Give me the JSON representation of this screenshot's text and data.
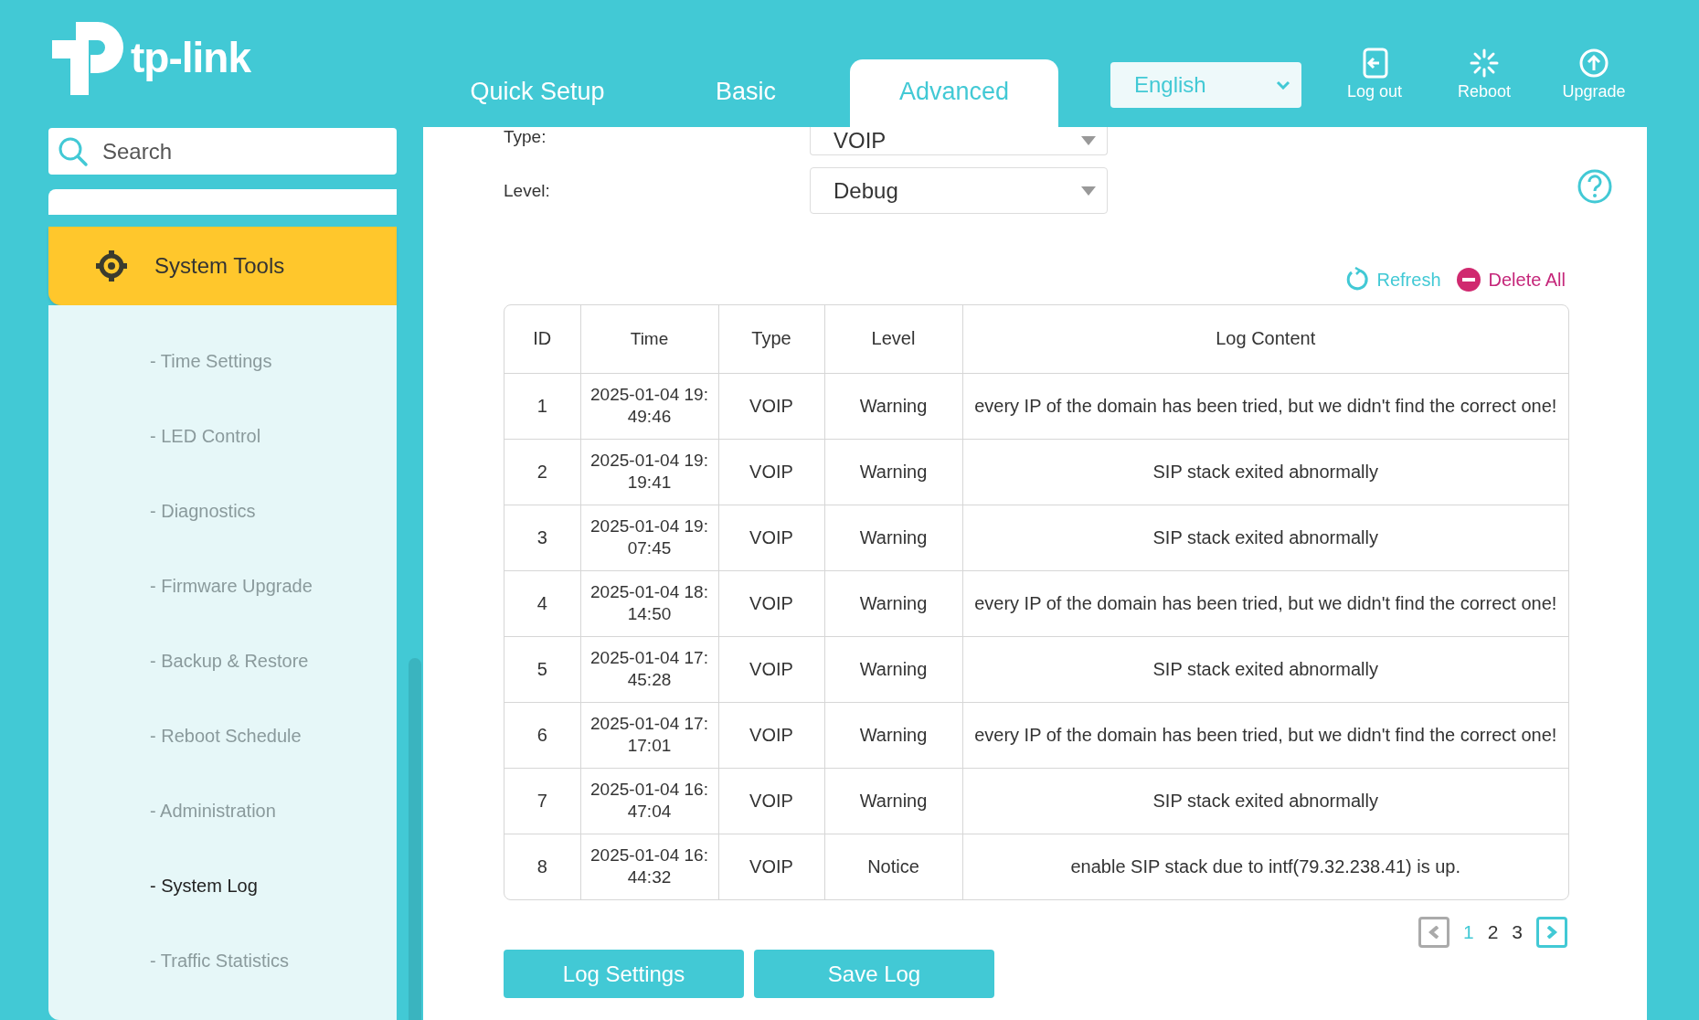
{
  "logo": {
    "text": "tp-link"
  },
  "tabs": [
    {
      "label": "Quick Setup",
      "selected": false
    },
    {
      "label": "Basic",
      "selected": false
    },
    {
      "label": "Advanced",
      "selected": true
    }
  ],
  "language": {
    "value": "English"
  },
  "header_actions": [
    {
      "kind": "logout",
      "label": "Log out"
    },
    {
      "kind": "reboot",
      "label": "Reboot"
    },
    {
      "kind": "upgrade",
      "label": "Upgrade"
    }
  ],
  "sidebar": {
    "search": {
      "placeholder": "Search"
    },
    "section": {
      "label": "System Tools",
      "expanded": true
    },
    "items": [
      {
        "label": "- Time Settings",
        "selected": false
      },
      {
        "label": "- LED Control",
        "selected": false
      },
      {
        "label": "- Diagnostics",
        "selected": false
      },
      {
        "label": "- Firmware Upgrade",
        "selected": false
      },
      {
        "label": "- Backup & Restore",
        "selected": false
      },
      {
        "label": "- Reboot Schedule",
        "selected": false
      },
      {
        "label": "- Administration",
        "selected": false
      },
      {
        "label": "- System Log",
        "selected": true
      },
      {
        "label": "- Traffic Statistics",
        "selected": false
      }
    ]
  },
  "filters": [
    {
      "label": "Type:",
      "value": "VOIP"
    },
    {
      "label": "Level:",
      "value": "Debug"
    }
  ],
  "actions": [
    {
      "kind": "refresh",
      "label": "Refresh"
    },
    {
      "kind": "delete",
      "label": "Delete All"
    }
  ],
  "table": {
    "columns": [
      "ID",
      "Time",
      "Type",
      "Level",
      "Log Content"
    ],
    "rows": [
      [
        "1",
        "2025-01-04 19:49:46",
        "VOIP",
        "Warning",
        "every IP of the domain has been tried, but we didn't find the correct one!"
      ],
      [
        "2",
        "2025-01-04 19:19:41",
        "VOIP",
        "Warning",
        "SIP stack exited abnormally"
      ],
      [
        "3",
        "2025-01-04 19:07:45",
        "VOIP",
        "Warning",
        "SIP stack exited abnormally"
      ],
      [
        "4",
        "2025-01-04 18:14:50",
        "VOIP",
        "Warning",
        "every IP of the domain has been tried, but we didn't find the correct one!"
      ],
      [
        "5",
        "2025-01-04 17:45:28",
        "VOIP",
        "Warning",
        "SIP stack exited abnormally"
      ],
      [
        "6",
        "2025-01-04 17:17:01",
        "VOIP",
        "Warning",
        "every IP of the domain has been tried, but we didn't find the correct one!"
      ],
      [
        "7",
        "2025-01-04 16:47:04",
        "VOIP",
        "Warning",
        "SIP stack exited abnormally"
      ],
      [
        "8",
        "2025-01-04 16:44:32",
        "VOIP",
        "Notice",
        "enable SIP stack due to intf(79.32.238.41) is up."
      ]
    ]
  },
  "pagination": {
    "prev_disabled": true,
    "next_disabled": false,
    "pages": [
      {
        "label": "1",
        "selected": true
      },
      {
        "label": "2",
        "selected": false
      },
      {
        "label": "3",
        "selected": false
      }
    ]
  },
  "buttons": [
    "Log Settings",
    "Save Log"
  ]
}
